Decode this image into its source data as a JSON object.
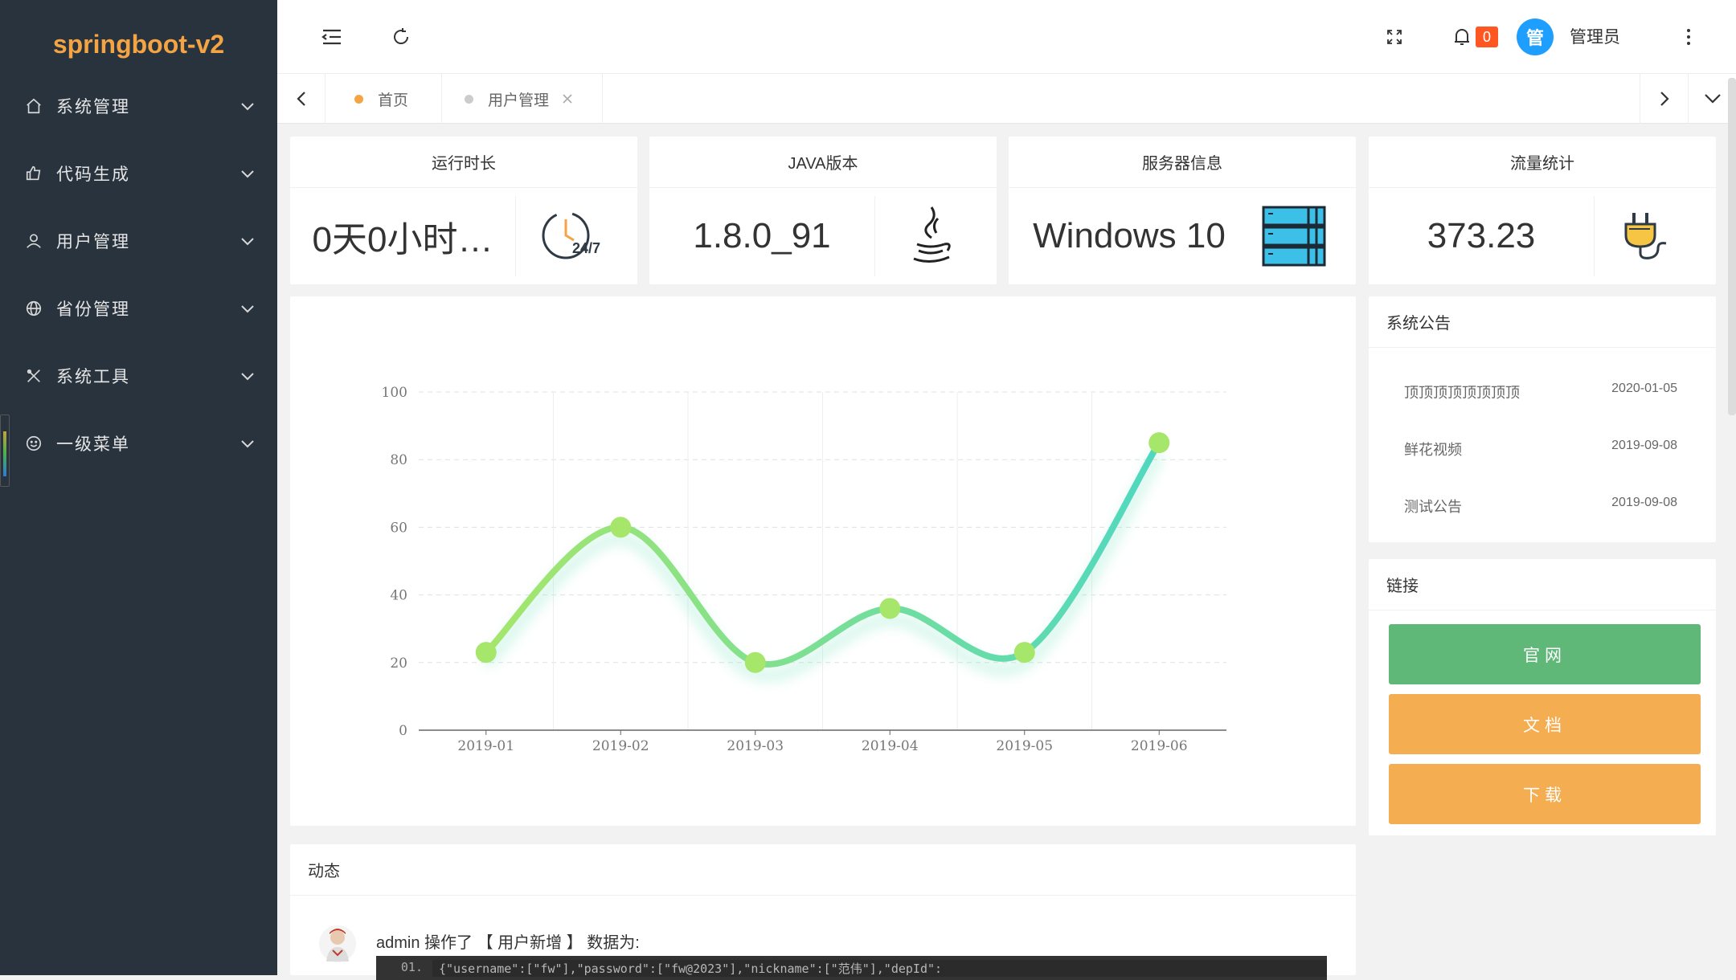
{
  "app": {
    "title": "springboot-v2"
  },
  "sidebar": {
    "items": [
      {
        "label": "系统管理",
        "icon": "home-icon"
      },
      {
        "label": "代码生成",
        "icon": "thumbs-up-icon"
      },
      {
        "label": "用户管理",
        "icon": "user-icon"
      },
      {
        "label": "省份管理",
        "icon": "globe-icon"
      },
      {
        "label": "系统工具",
        "icon": "tools-icon"
      },
      {
        "label": "一级菜单",
        "icon": "smile-icon"
      }
    ]
  },
  "header": {
    "notification_count": "0",
    "avatar_text": "管",
    "username": "管理员"
  },
  "tabs": [
    {
      "label": "首页",
      "dot_color": "#f5a443",
      "closable": false
    },
    {
      "label": "用户管理",
      "dot_color": "#cccccc",
      "closable": true
    }
  ],
  "stats": [
    {
      "title": "运行时长",
      "value": "0天0小时…",
      "icon": "clock-24-7-icon"
    },
    {
      "title": "JAVA版本",
      "value": "1.8.0_91",
      "icon": "java-icon"
    },
    {
      "title": "服务器信息",
      "value": "Windows 10",
      "icon": "server-rack-icon"
    },
    {
      "title": "流量统计",
      "value": "373.23",
      "icon": "power-plug-icon"
    }
  ],
  "chart_data": {
    "type": "line",
    "categories": [
      "2019-01",
      "2019-02",
      "2019-03",
      "2019-04",
      "2019-05",
      "2019-06"
    ],
    "series": [
      {
        "values": [
          23,
          60,
          20,
          36,
          23,
          85
        ]
      }
    ],
    "ylim": [
      0,
      100
    ],
    "yticks": [
      0,
      20,
      40,
      60,
      80,
      100
    ],
    "smooth": true,
    "grid": true,
    "colors": [
      "#a5e66b",
      "#4fd8c0"
    ]
  },
  "notices": {
    "title": "系统公告",
    "items": [
      {
        "title": "顶顶顶顶顶顶顶顶",
        "date": "2020-01-05"
      },
      {
        "title": "鲜花视频",
        "date": "2019-09-08"
      },
      {
        "title": "测试公告",
        "date": "2019-09-08"
      }
    ]
  },
  "links": {
    "title": "链接",
    "buttons": [
      {
        "label": "官网",
        "color": "#5fb878"
      },
      {
        "label": "文档",
        "color": "#f5ad51"
      },
      {
        "label": "下载",
        "color": "#f5ad51"
      }
    ]
  },
  "activity": {
    "title": "动态",
    "entry": "admin 操作了 【 用户新增 】 数据为:",
    "code_line_no": "01.",
    "code": "{\"username\":[\"fw\"],\"password\":[\"fw@2023\"],\"nickname\":[\"范伟\"],\"depId\":"
  }
}
